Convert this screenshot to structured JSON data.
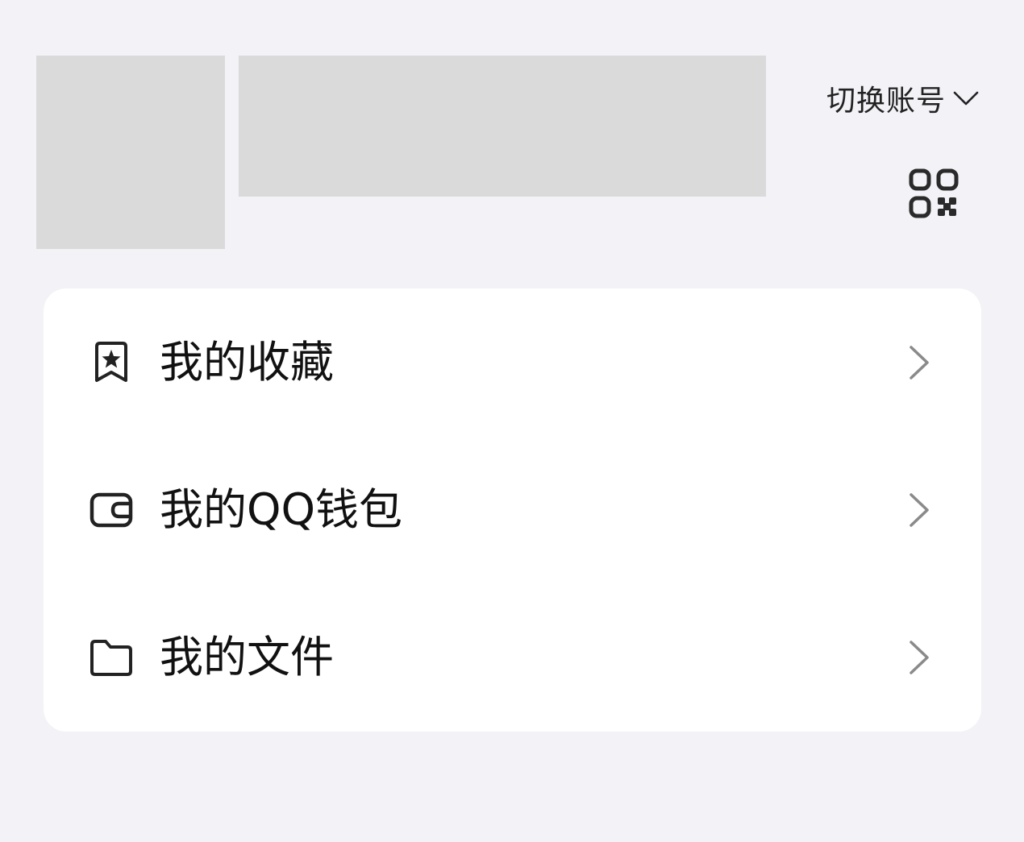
{
  "header": {
    "switch_account_label": "切换账号"
  },
  "icons": {
    "switch_chevron": "chevron-down-icon",
    "qr": "qr-code-icon"
  },
  "menu": {
    "items": [
      {
        "label": "我的收藏",
        "icon": "bookmark-star-icon"
      },
      {
        "label": "我的QQ钱包",
        "icon": "wallet-icon"
      },
      {
        "label": "我的文件",
        "icon": "folder-icon"
      }
    ]
  },
  "colors": {
    "background": "#f2f2f7",
    "card": "#ffffff",
    "placeholder": "#dadada",
    "text": "#111111",
    "chevron": "#8a8a8a"
  }
}
